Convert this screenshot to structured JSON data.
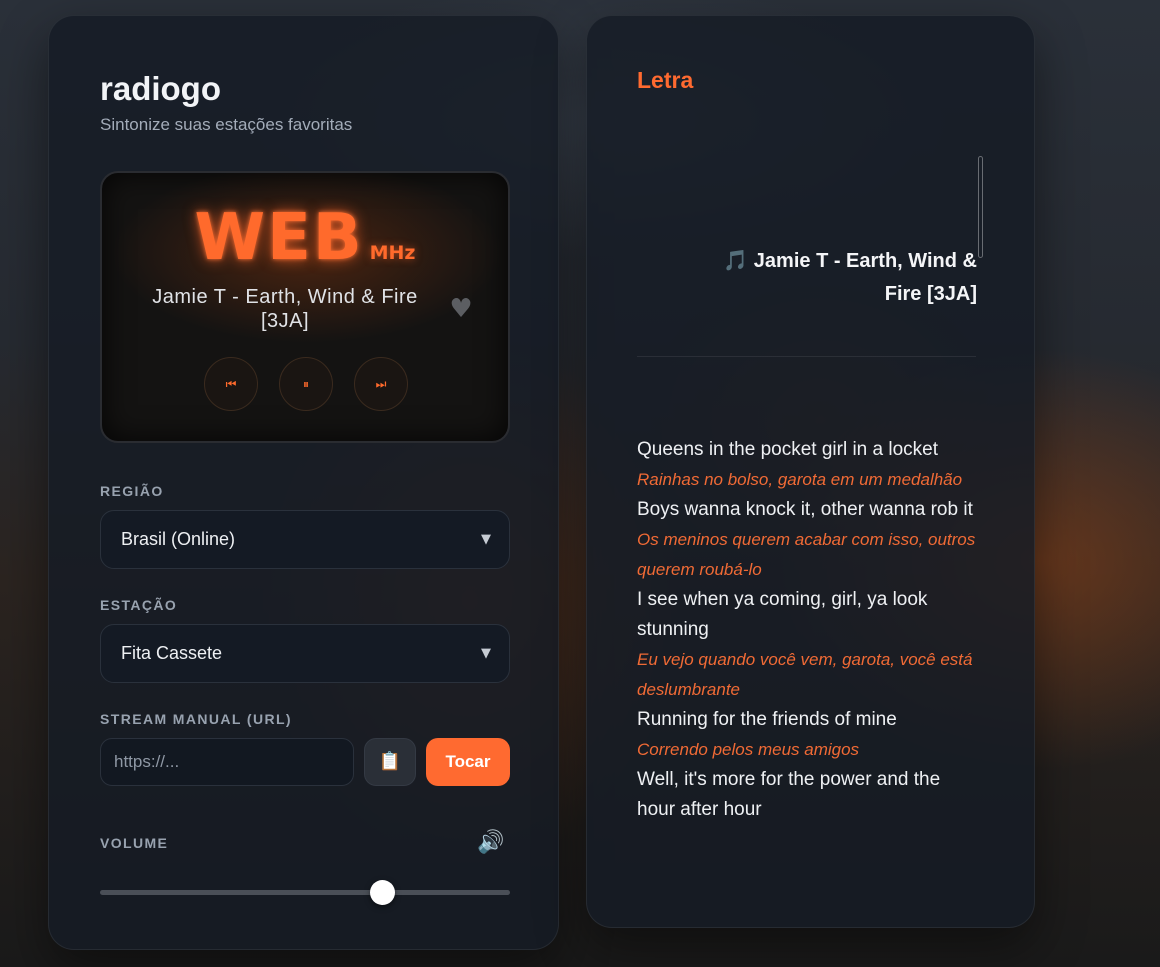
{
  "app": {
    "title": "radiogo",
    "subtitle": "Sintonize suas estações favoritas"
  },
  "display": {
    "frequency": "WEB",
    "unit": "MHz",
    "now_playing": "Jamie T - Earth, Wind & Fire [3JA]",
    "favorite_icon": "heart-icon",
    "controls": {
      "prev_icon": "⏮",
      "pause_icon": "⏸",
      "next_icon": "⏭"
    }
  },
  "region": {
    "label": "REGIÃO",
    "selected": "Brasil (Online)"
  },
  "station": {
    "label": "ESTAÇÃO",
    "selected": "Fita Cassete"
  },
  "stream": {
    "label": "STREAM MANUAL (URL)",
    "placeholder": "https://...",
    "paste_icon": "📋",
    "play_label": "Tocar"
  },
  "volume": {
    "label": "VOLUME",
    "icon": "🔊",
    "value": 0.69
  },
  "lyrics": {
    "heading": "Letra",
    "song_title": "🎵 Jamie T - Earth, Wind & Fire [3JA]",
    "lines": [
      {
        "text": "Queens in the pocket girl in a locket",
        "type": "original"
      },
      {
        "text": "Rainhas no bolso, garota em um medalhão",
        "type": "translation"
      },
      {
        "text": "Boys wanna knock it, other wanna rob it",
        "type": "original"
      },
      {
        "text": "Os meninos querem acabar com isso, outros querem roubá-lo",
        "type": "translation"
      },
      {
        "text": "I see when ya coming, girl, ya look stunning",
        "type": "original"
      },
      {
        "text": "Eu vejo quando você vem, garota, você está deslumbrante",
        "type": "translation"
      },
      {
        "text": "Running for the friends of mine",
        "type": "original"
      },
      {
        "text": "Correndo pelos meus amigos",
        "type": "translation"
      },
      {
        "text": "Well, it's more for the power and the hour after hour",
        "type": "original"
      }
    ]
  },
  "colors": {
    "accent": "#ff6a30",
    "card_bg": "#161b25"
  }
}
